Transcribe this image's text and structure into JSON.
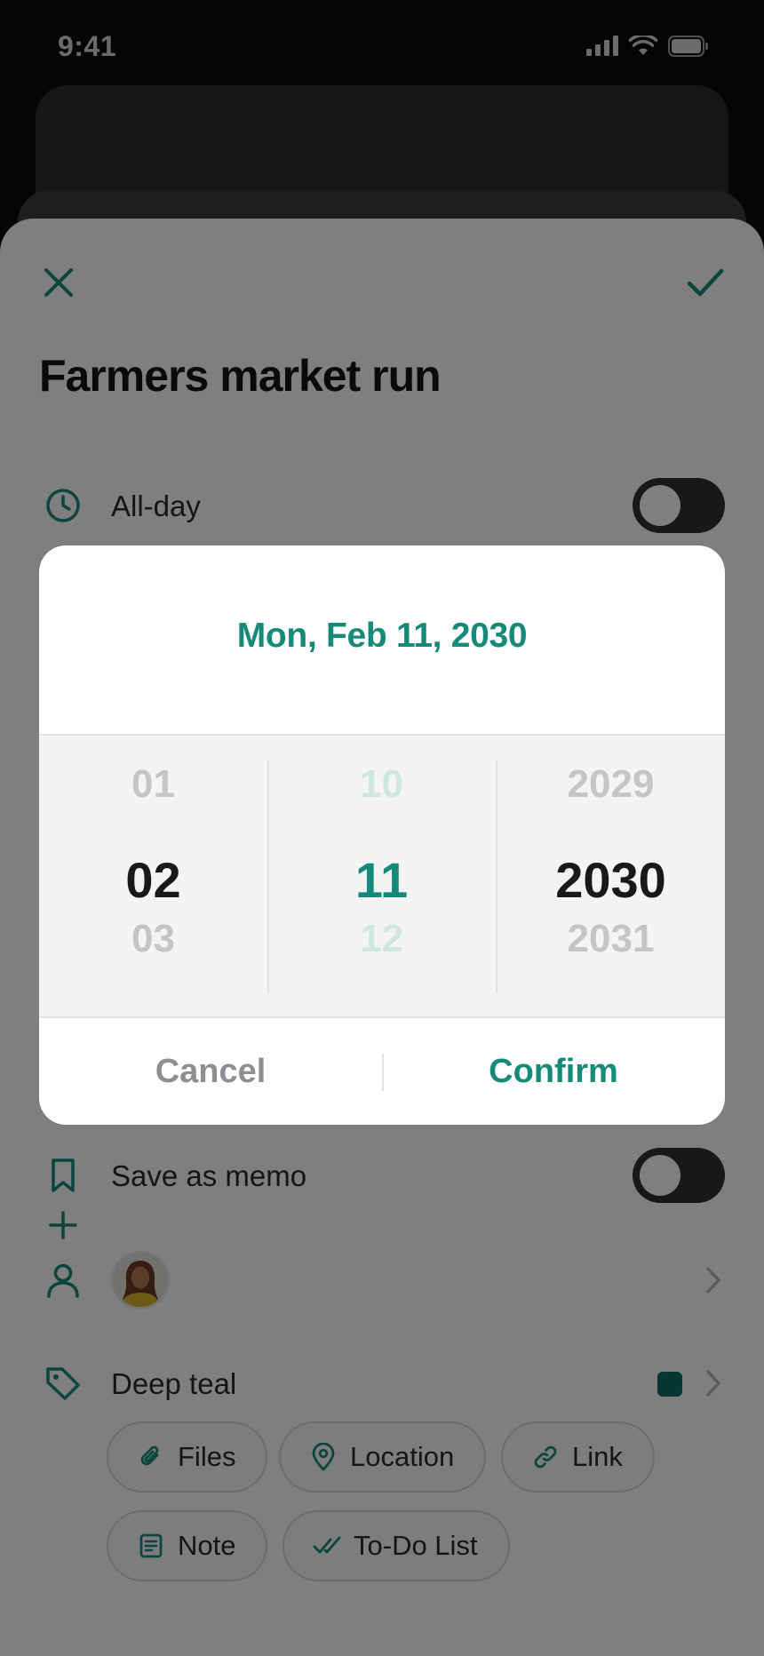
{
  "status_bar": {
    "time": "9:41"
  },
  "event": {
    "title": "Farmers market run",
    "all_day_label": "All-day",
    "memo_label": "Save as memo",
    "tag_label": "Deep teal",
    "tag_color": "#0f6b5e"
  },
  "attachments": {
    "chips": [
      {
        "label": "Files",
        "icon": "paperclip-icon"
      },
      {
        "label": "Location",
        "icon": "map-pin-icon"
      },
      {
        "label": "Link",
        "icon": "link-icon"
      },
      {
        "label": "Note",
        "icon": "note-icon"
      },
      {
        "label": "To-Do List",
        "icon": "checkmark-icon"
      }
    ]
  },
  "date_picker": {
    "header": "Mon, Feb 11, 2030",
    "month": {
      "prev": "01",
      "current": "02",
      "next": "03"
    },
    "day": {
      "prev": "10",
      "current": "11",
      "next": "12"
    },
    "year": {
      "prev": "2029",
      "current": "2030",
      "next": "2031"
    },
    "cancel_label": "Cancel",
    "confirm_label": "Confirm"
  },
  "colors": {
    "accent": "#168a78",
    "overlay": "rgba(0,0,0,0.5)"
  }
}
